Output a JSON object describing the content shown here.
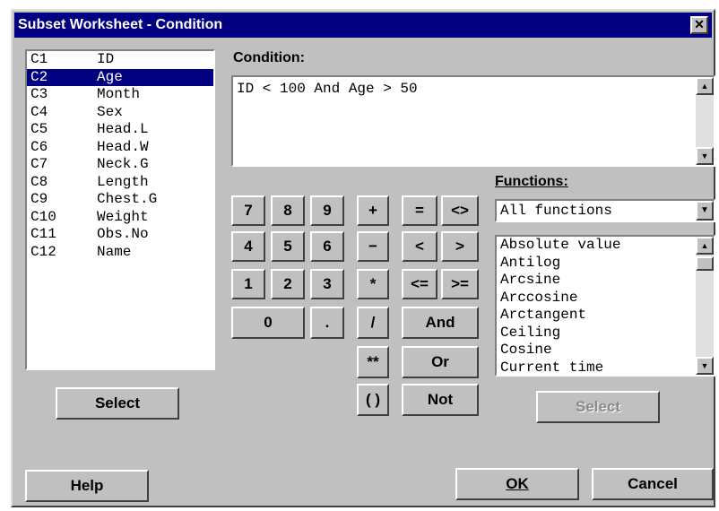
{
  "window": {
    "title": "Subset Worksheet - Condition",
    "close_glyph": "✕"
  },
  "variables": [
    {
      "col": "C1",
      "name": "ID",
      "selected": false
    },
    {
      "col": "C2",
      "name": "Age",
      "selected": true
    },
    {
      "col": "C3",
      "name": "Month",
      "selected": false
    },
    {
      "col": "C4",
      "name": "Sex",
      "selected": false
    },
    {
      "col": "C5",
      "name": "Head.L",
      "selected": false
    },
    {
      "col": "C6",
      "name": "Head.W",
      "selected": false
    },
    {
      "col": "C7",
      "name": "Neck.G",
      "selected": false
    },
    {
      "col": "C8",
      "name": "Length",
      "selected": false
    },
    {
      "col": "C9",
      "name": "Chest.G",
      "selected": false
    },
    {
      "col": "C10",
      "name": "Weight",
      "selected": false
    },
    {
      "col": "C11",
      "name": "Obs.No",
      "selected": false
    },
    {
      "col": "C12",
      "name": "Name",
      "selected": false
    }
  ],
  "select_left_label": "Select",
  "condition": {
    "label": "Condition:",
    "value": "ID < 100 And Age > 50"
  },
  "keypad": {
    "seven": "7",
    "eight": "8",
    "nine": "9",
    "four": "4",
    "five": "5",
    "six": "6",
    "one": "1",
    "two": "2",
    "three": "3",
    "zero": "0",
    "dot": "."
  },
  "operators": {
    "plus": "+",
    "minus": "−",
    "times": "*",
    "divide": "/",
    "power": "**",
    "parens": "( )",
    "eq": "=",
    "ne": "<>",
    "lt": "<",
    "gt": ">",
    "le": "<=",
    "ge": ">=",
    "and": "And",
    "or": "Or",
    "not": "Not"
  },
  "functions": {
    "label": "Functions:",
    "dropdown_value": "All functions",
    "items": [
      "Absolute value",
      "Antilog",
      "Arcsine",
      "Arccosine",
      "Arctangent",
      "Ceiling",
      "Cosine",
      "Current time"
    ],
    "select_label": "Select"
  },
  "footer": {
    "help": "Help",
    "ok": "OK",
    "cancel": "Cancel"
  },
  "icons": {
    "up": "▲",
    "down": "▼"
  },
  "colors": {
    "titlebar": "#000080",
    "selection": "#000080",
    "face": "#c0c0c0"
  }
}
